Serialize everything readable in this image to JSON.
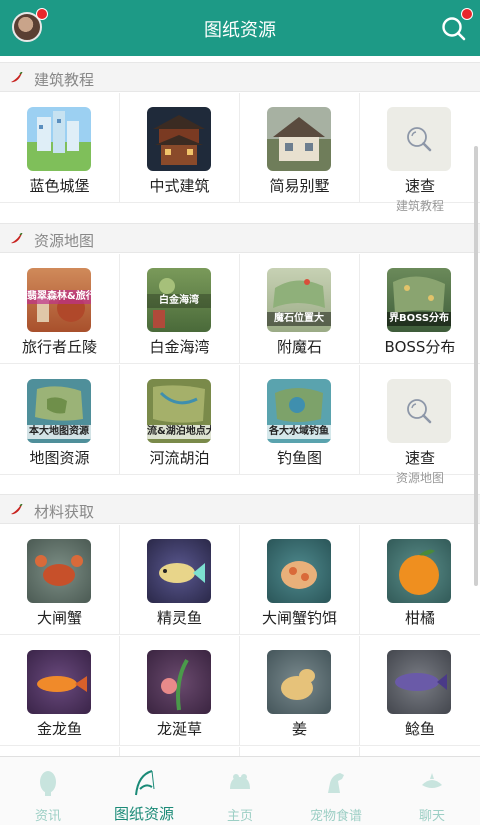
{
  "header": {
    "title": "图纸资源"
  },
  "sections": [
    {
      "label": "建筑教程",
      "items": [
        {
          "name": "蓝色城堡",
          "bg": "#6fb3e6"
        },
        {
          "name": "中式建筑",
          "bg": "#1f2a3a"
        },
        {
          "name": "简易别墅",
          "bg": "#8a8f7a"
        },
        {
          "name": "速查",
          "sub": "建筑教程"
        }
      ]
    },
    {
      "label": "资源地图",
      "items": [
        {
          "name": "旅行者丘陵",
          "caption": "翡翠森林&旅行",
          "bg": "#c27246"
        },
        {
          "name": "白金海湾",
          "caption": "白金海湾",
          "bg": "#5d7d4a"
        },
        {
          "name": "附魔石",
          "caption": "魔石位置大",
          "bg": "#b9c3a6"
        },
        {
          "name": "BOSS分布",
          "caption": "界BOSS分布",
          "bg": "#4c6f48"
        },
        {
          "name": "地图资源",
          "caption": "本大地图资源",
          "bg": "#4f8f9a"
        },
        {
          "name": "河流胡泊",
          "caption": "流&湖泊地点大",
          "bg": "#7a8a4a"
        },
        {
          "name": "钓鱼图",
          "caption": "各大水域钓鱼",
          "bg": "#5aa3ae"
        },
        {
          "name": "速查",
          "sub": "资源地图"
        }
      ]
    },
    {
      "label": "材料获取",
      "items": [
        {
          "name": "大闸蟹",
          "bg": "#5e7068"
        },
        {
          "name": "精灵鱼",
          "bg": "#3a3860"
        },
        {
          "name": "大闸蟹钓饵",
          "bg": "#366a6e"
        },
        {
          "name": "柑橘",
          "bg": "#3f6d6a"
        },
        {
          "name": "金龙鱼",
          "bg": "#4a2f5e"
        },
        {
          "name": "龙涎草",
          "bg": "#4a2f4e"
        },
        {
          "name": "姜",
          "bg": "#53656a"
        },
        {
          "name": "鲶鱼",
          "bg": "#56595f"
        }
      ]
    }
  ],
  "tabs": [
    {
      "label": "资讯",
      "active": false
    },
    {
      "label": "图纸资源",
      "active": true
    },
    {
      "label": "主页",
      "active": false
    },
    {
      "label": "宠物食谱",
      "active": false
    },
    {
      "label": "聊天",
      "active": false
    }
  ],
  "colors": {
    "accent": "#1d9a86",
    "badge": "#e8262b",
    "tab_inactive": "#9dcfc5"
  }
}
